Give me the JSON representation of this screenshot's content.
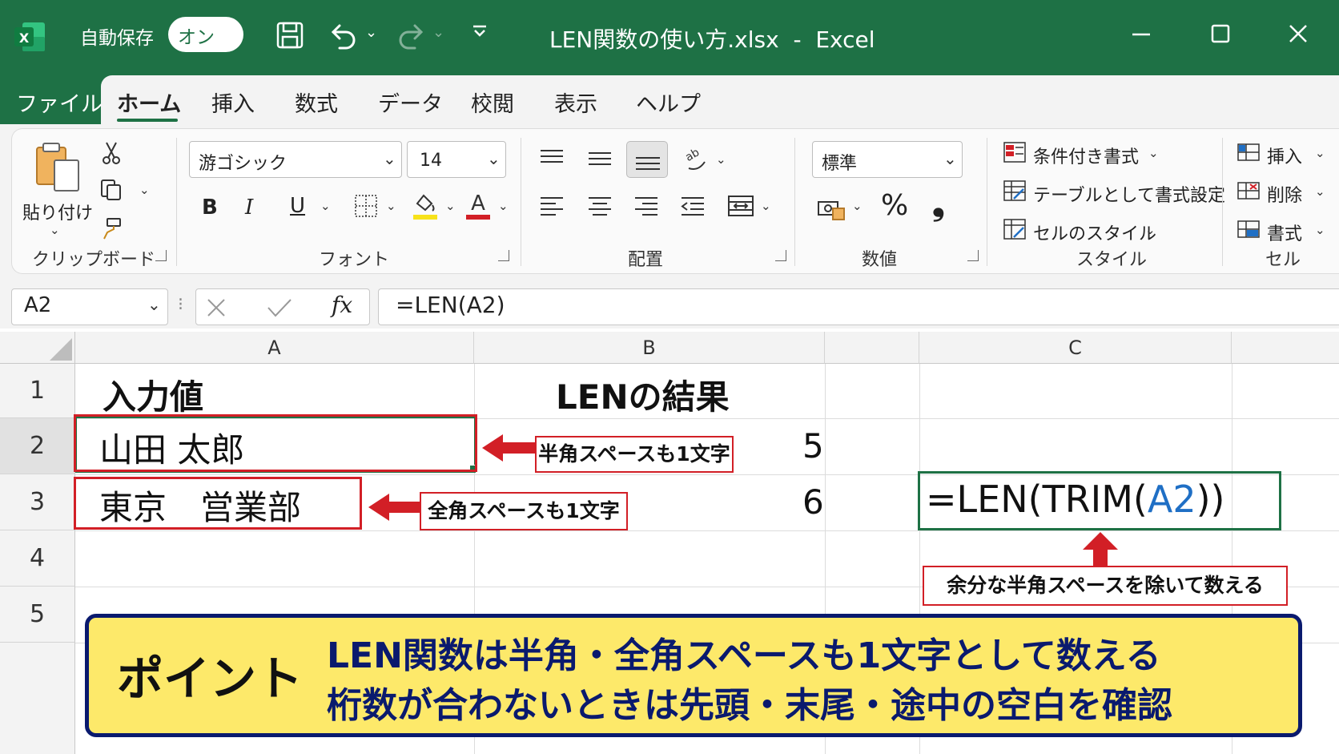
{
  "window": {
    "title": "LEN関数の使い方.xlsx  -  Excel",
    "app_icon_letter": "X",
    "autosave_label": "自動保存",
    "autosave_state": "オン"
  },
  "tabs": [
    "ファイル",
    "ホーム",
    "挿入",
    "数式",
    "データ",
    "校閲",
    "表示",
    "ヘルプ"
  ],
  "ribbon": {
    "clipboard": {
      "paste_label": "貼り付け",
      "group_label": "クリップボード"
    },
    "font": {
      "font_name": "游ゴシック",
      "font_size": "14",
      "bold": "B",
      "italic": "I",
      "underline": "U",
      "font_color_letter": "A",
      "group_label": "フォント"
    },
    "alignment": {
      "group_label": "配置"
    },
    "number": {
      "format": "標準",
      "percent": "%",
      "comma": "❟",
      "group_label": "数値"
    },
    "styles": {
      "conditional": "条件付き書式",
      "as_table": "テーブルとして書式設定",
      "cell_styles": "セルのスタイル",
      "group_label": "スタイル"
    },
    "cells": {
      "insert": "挿入",
      "delete": "削除",
      "format": "書式",
      "group_label": "セル"
    }
  },
  "formula_bar": {
    "name_box": "A2",
    "fx": "fx",
    "formula": "=LEN(A2)"
  },
  "grid": {
    "columns": [
      "A",
      "B",
      "C"
    ],
    "rows": [
      "1",
      "2",
      "3",
      "4",
      "5"
    ],
    "cells": {
      "A1": "入力値",
      "B1": "LENの結果",
      "A2": "山田 太郎",
      "B2": "5",
      "A3": "東京　営業部",
      "B3": "6"
    },
    "c3_formula": {
      "prefix": "=LEN(TRIM(",
      "ref": "A2",
      "suffix": "))"
    }
  },
  "annotations": {
    "row2_note": "半角スペースも1文字",
    "row3_note": "全角スペースも1文字",
    "trim_note": "余分な半角スペースを除いて数える"
  },
  "point": {
    "title": "ポイント",
    "line1": "LEN関数は半角・全角スペースも1文字として数える",
    "line2": "桁数が合わないときは先頭・末尾・途中の空白を確認"
  },
  "colors": {
    "excel_green": "#1e7145",
    "annotation_red": "#d21f26",
    "point_yellow": "#fde96a",
    "point_navy": "#0a1a6e",
    "ref_blue": "#1f6fc5"
  }
}
